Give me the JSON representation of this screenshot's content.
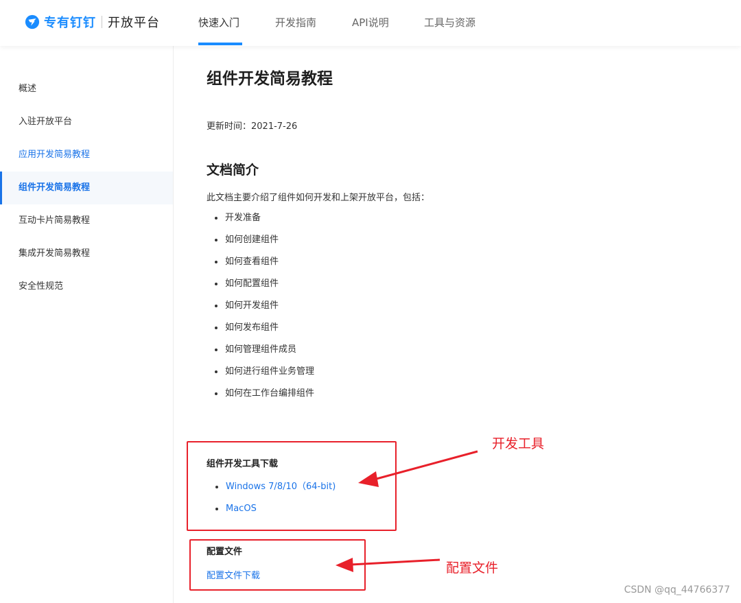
{
  "header": {
    "brand": "专有钉钉",
    "platform": "开放平台",
    "nav": [
      {
        "label": "快速入门",
        "active": true
      },
      {
        "label": "开发指南"
      },
      {
        "label": "API说明"
      },
      {
        "label": "工具与资源"
      }
    ]
  },
  "sidebar": {
    "items": [
      {
        "label": "概述"
      },
      {
        "label": "入驻开放平台"
      },
      {
        "label": "应用开发简易教程"
      },
      {
        "label": "组件开发简易教程",
        "active": true
      },
      {
        "label": "互动卡片简易教程"
      },
      {
        "label": "集成开发简易教程"
      },
      {
        "label": "安全性规范"
      }
    ]
  },
  "content": {
    "title": "组件开发简易教程",
    "updated": "更新时间：2021-7-26",
    "section_title": "文档简介",
    "intro": "此文档主要介绍了组件如何开发和上架开放平台，包括：",
    "topics": [
      "开发准备",
      "如何创建组件",
      "如何查看组件",
      "如何配置组件",
      "如何开发组件",
      "如何发布组件",
      "如何管理组件成员",
      "如何进行组件业务管理",
      "如何在工作台编排组件"
    ],
    "tools_title": "组件开发工具下载",
    "downloads": [
      "Windows 7/8/10（64-bit)",
      "MacOS"
    ],
    "config_title": "配置文件",
    "config_link": "配置文件下载"
  },
  "annotations": {
    "tool_label": "开发工具",
    "config_label": "配置文件",
    "color": "#e8202a"
  },
  "watermark": "CSDN @qq_44766377",
  "colors": {
    "accent": "#1a8cff",
    "link": "#1a73e8",
    "annotation": "#e8202a"
  }
}
